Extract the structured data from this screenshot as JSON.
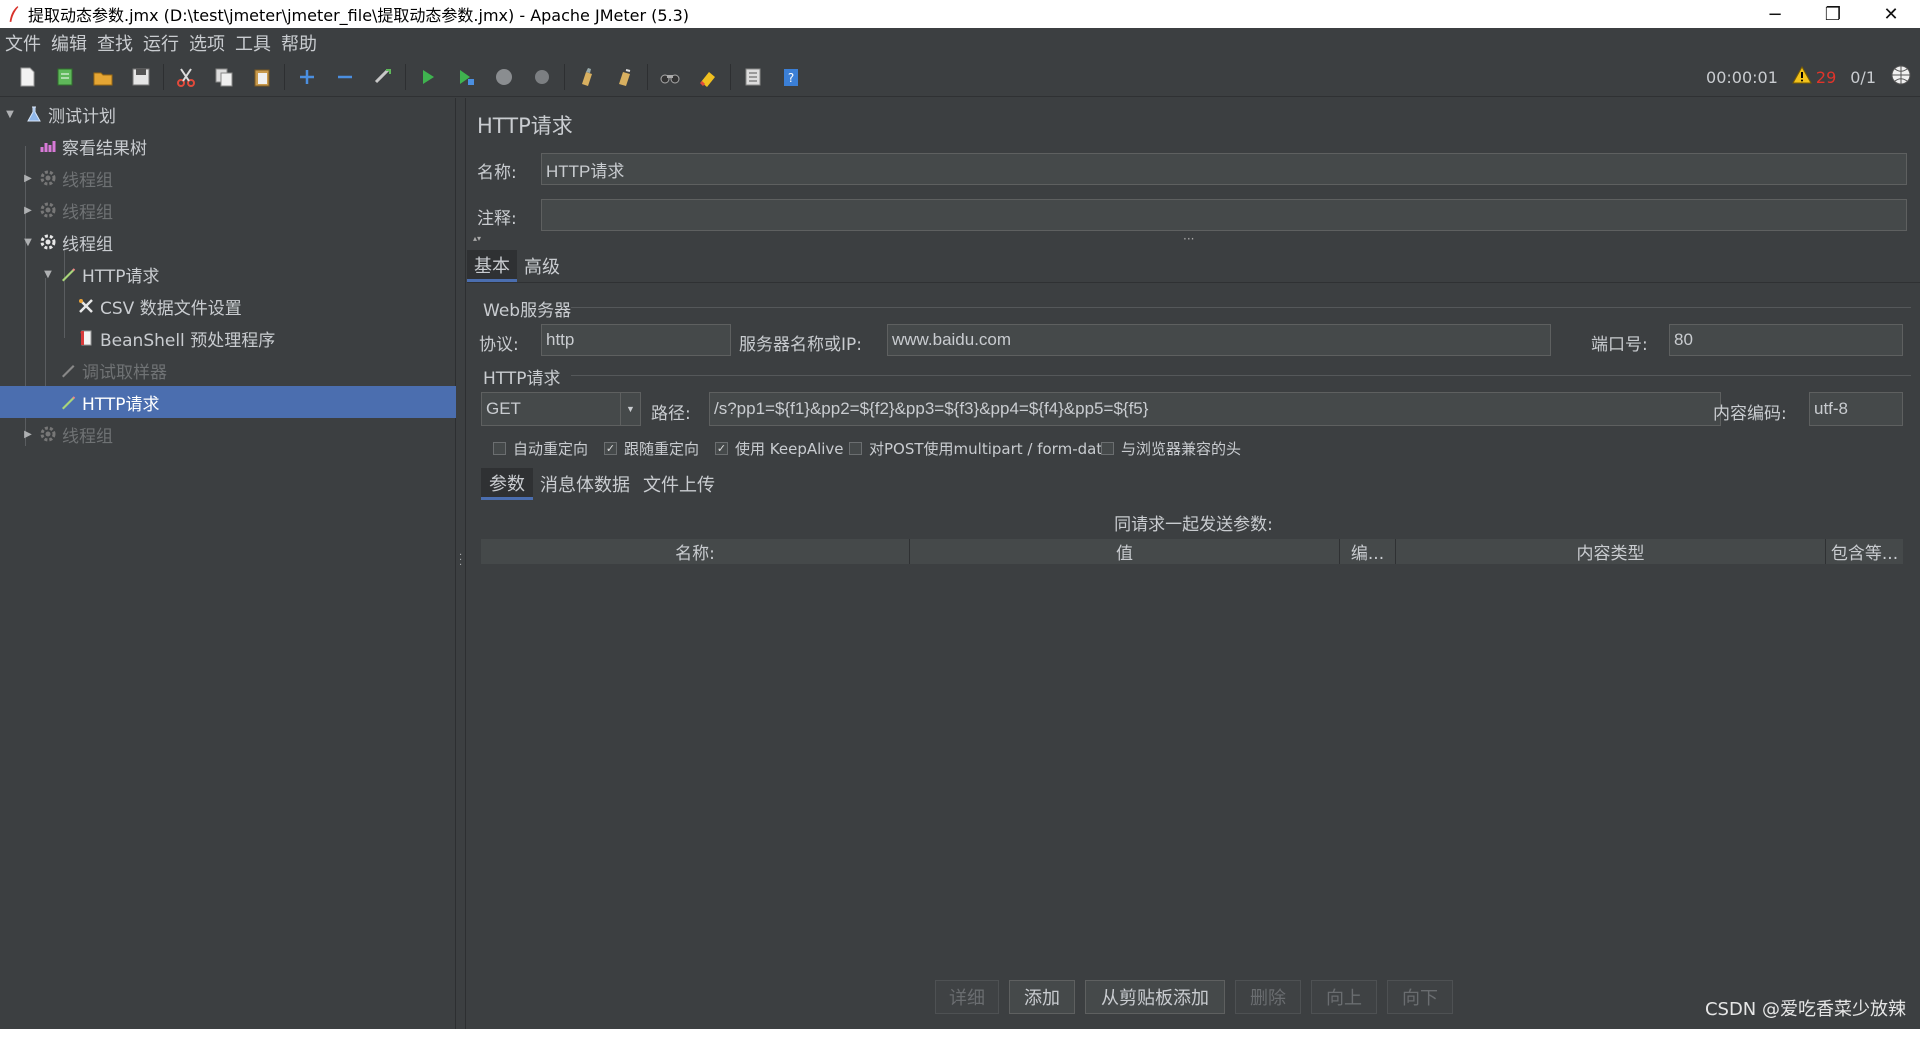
{
  "window": {
    "title": "提取动态参数.jmx (D:\\test\\jmeter\\jmeter_file\\提取动态参数.jmx) - Apache JMeter (5.3)",
    "minimize": "−",
    "restore": "❐",
    "close": "✕"
  },
  "menu": [
    "文件",
    "编辑",
    "查找",
    "运行",
    "选项",
    "工具",
    "帮助"
  ],
  "status": {
    "timer": "00:00:01",
    "warnings": "29",
    "threads": "0/1"
  },
  "tree": [
    {
      "label": "测试计划",
      "icon": "flask-icon",
      "enabled": true
    },
    {
      "label": "察看结果树",
      "icon": "chart-icon",
      "enabled": true
    },
    {
      "label": "线程组",
      "icon": "gear-icon",
      "enabled": false
    },
    {
      "label": "线程组",
      "icon": "gear-icon",
      "enabled": false
    },
    {
      "label": "线程组",
      "icon": "gear-icon",
      "enabled": true
    },
    {
      "label": "HTTP请求",
      "icon": "pencil-icon",
      "enabled": true
    },
    {
      "label": "CSV 数据文件设置",
      "icon": "tools-icon",
      "enabled": true
    },
    {
      "label": "BeanShell 预处理程序",
      "icon": "script-icon",
      "enabled": true
    },
    {
      "label": "调试取样器",
      "icon": "pencil-icon",
      "enabled": false
    },
    {
      "label": "HTTP请求",
      "icon": "pencil-icon",
      "enabled": true,
      "selected": true
    },
    {
      "label": "线程组",
      "icon": "gear-icon",
      "enabled": false
    }
  ],
  "panel": {
    "title": "HTTP请求",
    "name_label": "名称:",
    "name_value": "HTTP请求",
    "comment_label": "注释:",
    "comment_value": "",
    "tabs": [
      "基本",
      "高级"
    ],
    "web_server": {
      "group_title": "Web服务器",
      "protocol_label": "协议:",
      "protocol_value": "http",
      "server_label": "服务器名称或IP:",
      "server_value": "www.baidu.com",
      "port_label": "端口号:",
      "port_value": "80"
    },
    "http_request": {
      "group_title": "HTTP请求",
      "method": "GET",
      "path_label": "路径:",
      "path_value": "/s?pp1=${f1}&pp2=${f2}&pp3=${f3}&pp4=${f4}&pp5=${f5}",
      "encoding_label": "内容编码:",
      "encoding_value": "utf-8"
    },
    "checkboxes": [
      {
        "label": "自动重定向",
        "checked": false
      },
      {
        "label": "跟随重定向",
        "checked": true
      },
      {
        "label": "使用 KeepAlive",
        "checked": true
      },
      {
        "label": "对POST使用multipart / form-data",
        "checked": false
      },
      {
        "label": "与浏览器兼容的头",
        "checked": false
      }
    ],
    "sub_tabs": [
      "参数",
      "消息体数据",
      "文件上传"
    ],
    "params_caption": "同请求一起发送参数:",
    "columns": [
      "名称:",
      "值",
      "编...",
      "内容类型",
      "包含等..."
    ],
    "buttons": [
      {
        "label": "详细",
        "enabled": false
      },
      {
        "label": "添加",
        "enabled": true
      },
      {
        "label": "从剪贴板添加",
        "enabled": true
      },
      {
        "label": "删除",
        "enabled": false
      },
      {
        "label": "向上",
        "enabled": false
      },
      {
        "label": "向下",
        "enabled": false
      }
    ]
  },
  "watermark": "CSDN @爱吃香菜少放辣",
  "colors": {
    "background": "#3c3f41",
    "selection": "#4b6eaf",
    "field": "#45494a",
    "warning": "#e0342a"
  }
}
